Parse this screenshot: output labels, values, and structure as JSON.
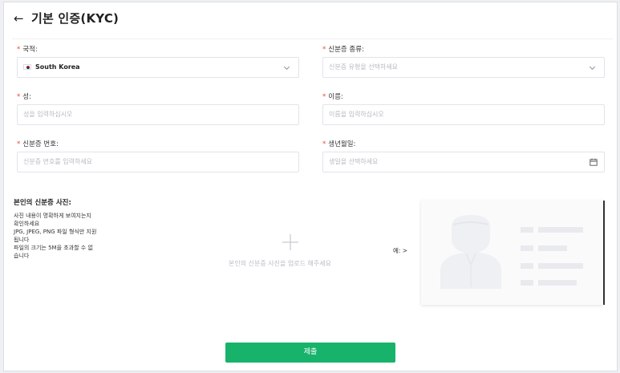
{
  "header": {
    "back_icon": "arrow-left-icon",
    "title": "기본 인증(KYC)"
  },
  "form": {
    "required_mark": "*",
    "nationality": {
      "label": "국적:",
      "value": "South Korea",
      "flag_icon": "south-korea-flag-icon"
    },
    "id_type": {
      "label": "신분증 종류:",
      "placeholder": "신분증 유형을 선택하세요"
    },
    "last_name": {
      "label": "성:",
      "placeholder": "성을 입력하십시오"
    },
    "first_name": {
      "label": "이름:",
      "placeholder": "이름을 입력하십시오"
    },
    "id_number": {
      "label": "신분증 번호:",
      "placeholder": "신분증 번호를 입력하세요"
    },
    "birth_date": {
      "label": "생년월일:",
      "placeholder": "생일을 선택하세요",
      "icon": "calendar-icon"
    },
    "id_photo": {
      "title": "본인의 신분증 사진:",
      "description_lines": [
        "사진 내용이 명확하게 보여지는지",
        "확인하세요",
        "JPG, JPEG, PNG 파일 형식만 지원",
        "됩니다",
        "파일의 크기는 5M을 초과할 수 없",
        "습니다"
      ],
      "upload_hint": "본인의 신분증 사진을 업로드 해주세요",
      "example_label": "예: >"
    },
    "submit_label": "제출"
  },
  "colors": {
    "accent": "#18b36b",
    "required": "#e8483b"
  }
}
